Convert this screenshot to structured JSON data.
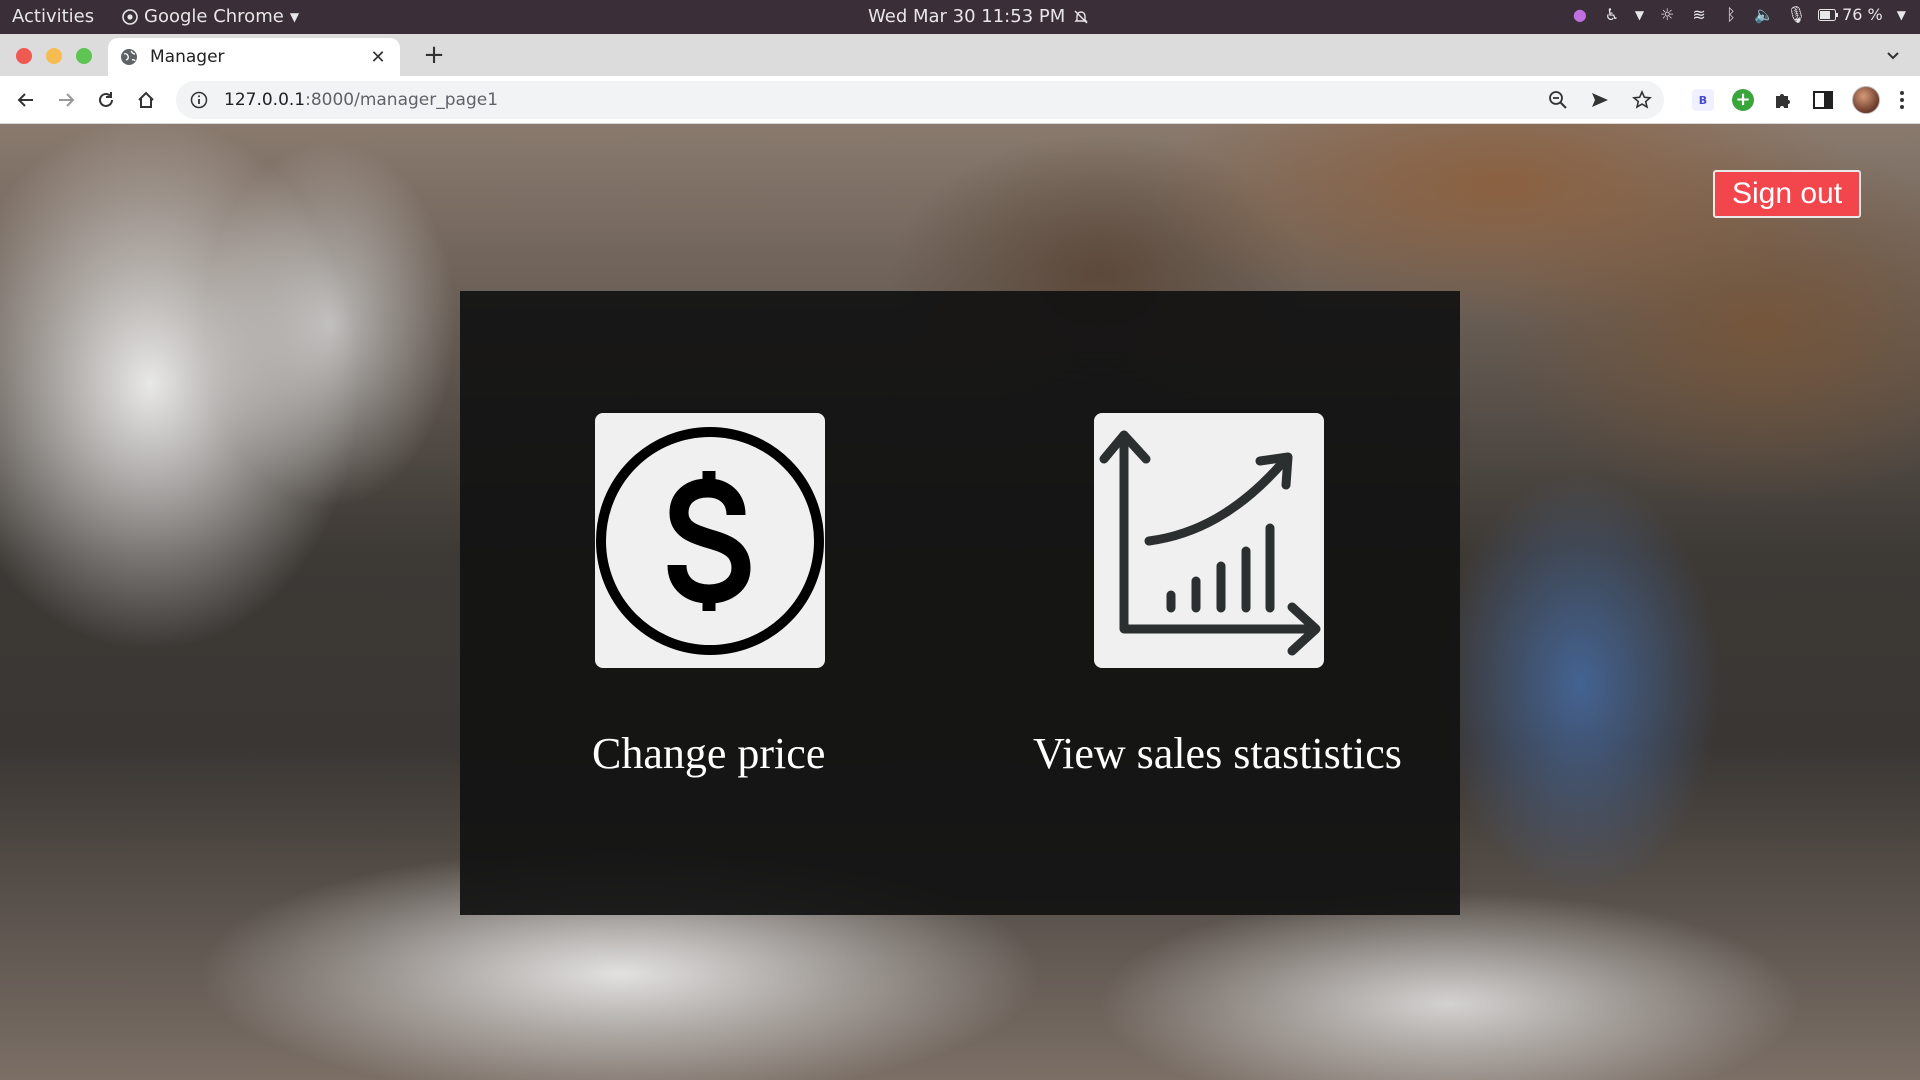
{
  "system_bar": {
    "activities": "Activities",
    "app_name": "Google Chrome",
    "datetime": "Wed Mar 30  11:53 PM",
    "battery": "76 %"
  },
  "browser": {
    "tab_title": "Manager",
    "url_host": "127.0.0.1",
    "url_path": ":8000/manager_page1",
    "extension_b_label": "B"
  },
  "page": {
    "sign_out_label": "Sign out",
    "options": [
      {
        "label": "Change price",
        "icon": "dollar-coin-icon"
      },
      {
        "label": "View sales stastistics",
        "icon": "growth-chart-icon"
      }
    ]
  },
  "colors": {
    "sign_out_bg": "#f2464c",
    "panel_bg": "#121212",
    "card_bg": "#f0f0f0"
  }
}
